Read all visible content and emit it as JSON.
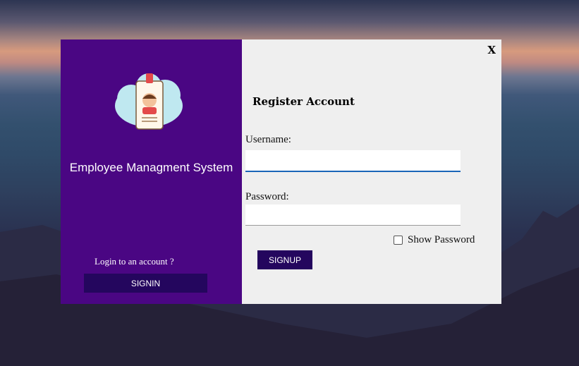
{
  "left_panel": {
    "app_title": "Employee Managment System",
    "login_prompt": "Login to an account ?",
    "signin_label": "SIGNIN",
    "accent_color": "#4a0683"
  },
  "right_panel": {
    "close_label": "X",
    "heading": "Register Account",
    "username_label": "Username:",
    "username_value": "",
    "password_label": "Password:",
    "password_value": "",
    "show_password_label": "Show Password",
    "show_password_checked": false,
    "signup_label": "SIGNUP",
    "button_color": "#24065e"
  },
  "icons": {
    "logo": "employee-id-card-icon"
  }
}
